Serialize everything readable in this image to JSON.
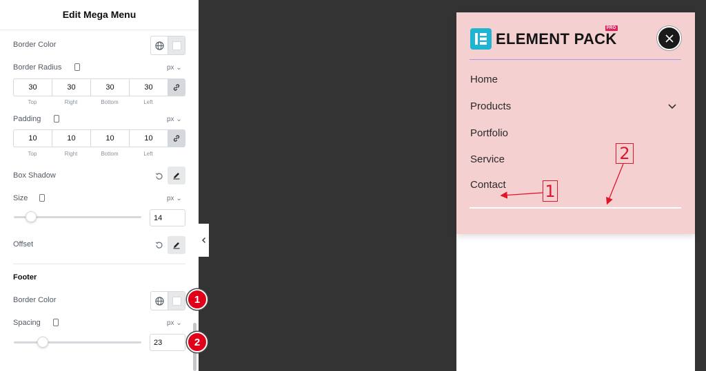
{
  "panel": {
    "title": "Edit Mega Menu",
    "border_color_label": "Border Color",
    "border_radius": {
      "label": "Border Radius",
      "unit": "px ⌄",
      "values": [
        "30",
        "30",
        "30",
        "30"
      ],
      "sides": [
        "Top",
        "Right",
        "Bottom",
        "Left"
      ]
    },
    "padding": {
      "label": "Padding",
      "unit": "px ⌄",
      "values": [
        "10",
        "10",
        "10",
        "10"
      ],
      "sides": [
        "Top",
        "Right",
        "Bottom",
        "Left"
      ]
    },
    "box_shadow_label": "Box Shadow",
    "size": {
      "label": "Size",
      "unit": "px ⌄",
      "value": "14"
    },
    "offset_label": "Offset",
    "footer": {
      "title": "Footer",
      "border_color_label": "Border Color",
      "spacing": {
        "label": "Spacing",
        "unit": "px ⌄",
        "value": "23"
      }
    },
    "badges": [
      "1",
      "2"
    ]
  },
  "preview": {
    "logo_text": "ELEMENT PACK",
    "pro_tag": "PRO",
    "menu_items": [
      "Home",
      "Products",
      "Portfolio",
      "Service",
      "Contact"
    ],
    "callouts": [
      "1",
      "2"
    ]
  },
  "colors": {
    "accent_badge": "#e0001a",
    "menu_background": "#f5d0d0",
    "logo_mark": "#1fb4cf",
    "annotation": "#e0142b"
  },
  "icons": [
    "globe-icon",
    "responsive-device-icon",
    "link-icon",
    "reset-icon",
    "pencil-icon",
    "chevron-left-icon",
    "close-icon",
    "chevron-down-icon",
    "element-pack-logo-icon"
  ]
}
